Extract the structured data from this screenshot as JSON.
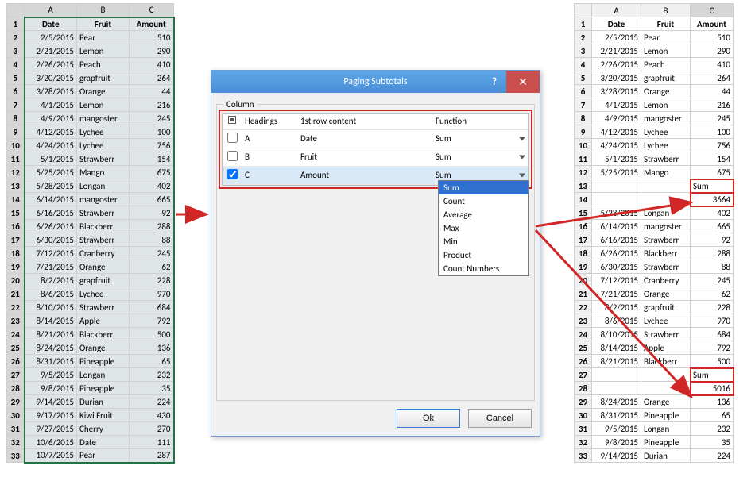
{
  "headers": {
    "date": "Date",
    "fruit": "Fruit",
    "amount": "Amount",
    "colA": "A",
    "colB": "B",
    "colC": "C"
  },
  "left_rows": [
    {
      "n": 2,
      "d": "2/5/2015",
      "f": "Pear",
      "a": 510
    },
    {
      "n": 3,
      "d": "2/21/2015",
      "f": "Lemon",
      "a": 290
    },
    {
      "n": 4,
      "d": "2/26/2015",
      "f": "Peach",
      "a": 410
    },
    {
      "n": 5,
      "d": "3/20/2015",
      "f": "grapfruit",
      "a": 264
    },
    {
      "n": 6,
      "d": "3/28/2015",
      "f": "Orange",
      "a": 44
    },
    {
      "n": 7,
      "d": "4/1/2015",
      "f": "Lemon",
      "a": 216
    },
    {
      "n": 8,
      "d": "4/9/2015",
      "f": "mangoster",
      "a": 245
    },
    {
      "n": 9,
      "d": "4/12/2015",
      "f": "Lychee",
      "a": 100
    },
    {
      "n": 10,
      "d": "4/24/2015",
      "f": "Lychee",
      "a": 756
    },
    {
      "n": 11,
      "d": "5/1/2015",
      "f": "Strawberr",
      "a": 154
    },
    {
      "n": 12,
      "d": "5/25/2015",
      "f": "Mango",
      "a": 675
    },
    {
      "n": 13,
      "d": "5/28/2015",
      "f": "Longan",
      "a": 402
    },
    {
      "n": 14,
      "d": "6/14/2015",
      "f": "mangoster",
      "a": 665
    },
    {
      "n": 15,
      "d": "6/16/2015",
      "f": "Strawberr",
      "a": 92
    },
    {
      "n": 16,
      "d": "6/26/2015",
      "f": "Blackberr",
      "a": 288
    },
    {
      "n": 17,
      "d": "6/30/2015",
      "f": "Strawberr",
      "a": 88
    },
    {
      "n": 18,
      "d": "7/12/2015",
      "f": "Cranberry",
      "a": 245
    },
    {
      "n": 19,
      "d": "7/21/2015",
      "f": "Orange",
      "a": 62
    },
    {
      "n": 20,
      "d": "8/2/2015",
      "f": "grapfruit",
      "a": 228
    },
    {
      "n": 21,
      "d": "8/6/2015",
      "f": "Lychee",
      "a": 970
    },
    {
      "n": 22,
      "d": "8/10/2015",
      "f": "Strawberr",
      "a": 684
    },
    {
      "n": 23,
      "d": "8/14/2015",
      "f": "Apple",
      "a": 792
    },
    {
      "n": 24,
      "d": "8/21/2015",
      "f": "Blackberr",
      "a": 500
    },
    {
      "n": 25,
      "d": "8/24/2015",
      "f": "Orange",
      "a": 136
    },
    {
      "n": 26,
      "d": "8/31/2015",
      "f": "Pineapple",
      "a": 65
    },
    {
      "n": 27,
      "d": "9/5/2015",
      "f": "Longan",
      "a": 232
    },
    {
      "n": 28,
      "d": "9/8/2015",
      "f": "Pineapple",
      "a": 35
    },
    {
      "n": 29,
      "d": "9/14/2015",
      "f": "Durian",
      "a": 224
    },
    {
      "n": 30,
      "d": "9/17/2015",
      "f": "Kiwi Fruit",
      "a": 430
    },
    {
      "n": 31,
      "d": "9/27/2015",
      "f": "Cherry",
      "a": 270
    },
    {
      "n": 32,
      "d": "10/6/2015",
      "f": "Date",
      "a": 111
    },
    {
      "n": 33,
      "d": "10/7/2015",
      "f": "Pear",
      "a": 287
    }
  ],
  "right_rows": [
    {
      "n": 2,
      "d": "2/5/2015",
      "f": "Pear",
      "a": "510"
    },
    {
      "n": 3,
      "d": "2/21/2015",
      "f": "Lemon",
      "a": "290"
    },
    {
      "n": 4,
      "d": "2/26/2015",
      "f": "Peach",
      "a": "410"
    },
    {
      "n": 5,
      "d": "3/20/2015",
      "f": "grapfruit",
      "a": "264"
    },
    {
      "n": 6,
      "d": "3/28/2015",
      "f": "Orange",
      "a": "44"
    },
    {
      "n": 7,
      "d": "4/1/2015",
      "f": "Lemon",
      "a": "216"
    },
    {
      "n": 8,
      "d": "4/9/2015",
      "f": "mangoster",
      "a": "245"
    },
    {
      "n": 9,
      "d": "4/12/2015",
      "f": "Lychee",
      "a": "100"
    },
    {
      "n": 10,
      "d": "4/24/2015",
      "f": "Lychee",
      "a": "756"
    },
    {
      "n": 11,
      "d": "5/1/2015",
      "f": "Strawberr",
      "a": "154"
    },
    {
      "n": 12,
      "d": "5/25/2015",
      "f": "Mango",
      "a": "675"
    },
    {
      "n": 13,
      "d": "",
      "f": "",
      "a": "Sum",
      "sum": true
    },
    {
      "n": 14,
      "d": "",
      "f": "",
      "a": "3664",
      "sum": true
    },
    {
      "n": 15,
      "d": "5/28/2015",
      "f": "Longan",
      "a": "402"
    },
    {
      "n": 16,
      "d": "6/14/2015",
      "f": "mangoster",
      "a": "665"
    },
    {
      "n": 17,
      "d": "6/16/2015",
      "f": "Strawberr",
      "a": "92"
    },
    {
      "n": 18,
      "d": "6/26/2015",
      "f": "Blackberr",
      "a": "288"
    },
    {
      "n": 19,
      "d": "6/30/2015",
      "f": "Strawberr",
      "a": "88"
    },
    {
      "n": 20,
      "d": "7/12/2015",
      "f": "Cranberry",
      "a": "245"
    },
    {
      "n": 21,
      "d": "7/21/2015",
      "f": "Orange",
      "a": "62"
    },
    {
      "n": 22,
      "d": "8/2/2015",
      "f": "grapfruit",
      "a": "228"
    },
    {
      "n": 23,
      "d": "8/6/2015",
      "f": "Lychee",
      "a": "970"
    },
    {
      "n": 24,
      "d": "8/10/2015",
      "f": "Strawberr",
      "a": "684"
    },
    {
      "n": 25,
      "d": "8/14/2015",
      "f": "Apple",
      "a": "792"
    },
    {
      "n": 26,
      "d": "8/21/2015",
      "f": "Blackberr",
      "a": "500"
    },
    {
      "n": 27,
      "d": "",
      "f": "",
      "a": "Sum",
      "sum": true
    },
    {
      "n": 28,
      "d": "",
      "f": "",
      "a": "5016",
      "sum": true
    },
    {
      "n": 29,
      "d": "8/24/2015",
      "f": "Orange",
      "a": "136"
    },
    {
      "n": 30,
      "d": "8/31/2015",
      "f": "Pineapple",
      "a": "65"
    },
    {
      "n": 31,
      "d": "9/5/2015",
      "f": "Longan",
      "a": "232"
    },
    {
      "n": 32,
      "d": "9/8/2015",
      "f": "Pineapple",
      "a": "35"
    },
    {
      "n": 33,
      "d": "9/14/2015",
      "f": "Durian",
      "a": "224"
    }
  ],
  "dialog": {
    "title": "Paging Subtotals",
    "group_label": "Column",
    "cols": {
      "cb": "",
      "heading": "Headings",
      "content": "1st row content",
      "func": "Function"
    },
    "rows": [
      {
        "col": "A",
        "content": "Date",
        "func": "Sum",
        "checked": false
      },
      {
        "col": "B",
        "content": "Fruit",
        "func": "Sum",
        "checked": false
      },
      {
        "col": "C",
        "content": "Amount",
        "func": "Sum",
        "checked": true
      }
    ],
    "dropdown": [
      "Sum",
      "Count",
      "Average",
      "Max",
      "Min",
      "Product",
      "Count Numbers"
    ],
    "ok": "Ok",
    "cancel": "Cancel"
  }
}
